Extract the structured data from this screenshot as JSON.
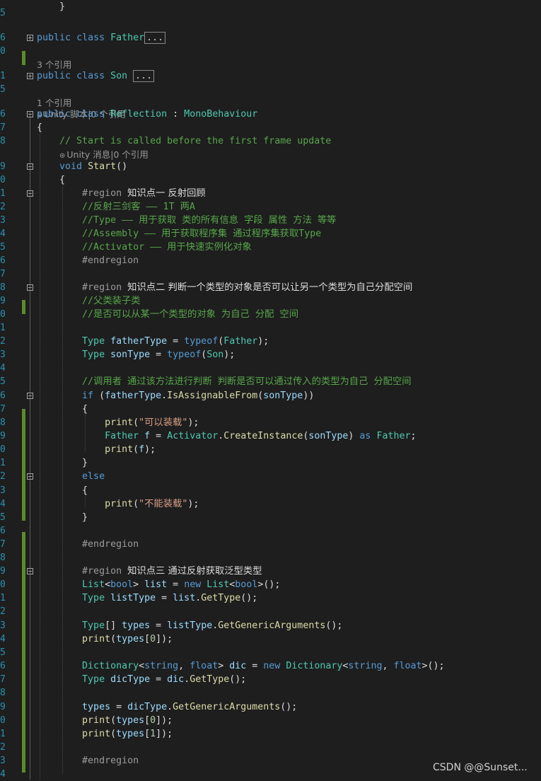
{
  "colors": {
    "background": "#1e1e1e",
    "keyword": "#569cd6",
    "type": "#4ec9b0",
    "comment": "#57a64a",
    "method": "#dcdcaa",
    "string": "#d69d85",
    "number": "#b5cea8",
    "preprocessor": "#9b9b9b",
    "line_number": "#2b91af",
    "change_bar": "#5b8b2b"
  },
  "line_numbers": [
    "5",
    "6",
    "0",
    "",
    "1",
    "5",
    "",
    "6",
    "7",
    "8",
    "",
    "9",
    "0",
    "1",
    "2",
    "3",
    "4",
    "5",
    "6",
    "7",
    "8",
    "9",
    "0",
    "1",
    "2",
    "3",
    "4",
    "5",
    "6",
    "7",
    "8",
    "9",
    "0",
    "1",
    "2",
    "3",
    "4",
    "5",
    "6",
    "7",
    "8",
    "9",
    "0",
    "1",
    "2",
    "3",
    "4",
    "5",
    "6",
    "7",
    "8",
    "9",
    "0",
    "1",
    "2",
    "3",
    "4"
  ],
  "code_lens": {
    "father_refs": "3 个引用",
    "son_refs": "1 个引用",
    "reflection_refs": "Unity 脚本|0 个引用",
    "start_refs": "Unity 消息|0 个引用"
  },
  "collapsed_marker": "...",
  "lines": [
    [],
    [
      {
        "t": "public",
        "c": "kw"
      },
      {
        "t": " "
      },
      {
        "t": "class",
        "c": "kw"
      },
      {
        "t": " "
      },
      {
        "t": "Father",
        "c": "ty"
      }
    ],
    [],
    [],
    [
      {
        "t": "public",
        "c": "kw"
      },
      {
        "t": " "
      },
      {
        "t": "class",
        "c": "kw"
      },
      {
        "t": " "
      },
      {
        "t": "Son",
        "c": "ty"
      },
      {
        "t": " "
      }
    ],
    [],
    [],
    [
      {
        "t": "public",
        "c": "kw"
      },
      {
        "t": " "
      },
      {
        "t": "class",
        "c": "kw"
      },
      {
        "t": " "
      },
      {
        "t": "Reflection",
        "c": "ty"
      },
      {
        "t": " : "
      },
      {
        "t": "MonoBehaviour",
        "c": "ty"
      }
    ],
    [
      {
        "t": "{"
      }
    ],
    [
      {
        "t": "    // Start is called before the first frame update",
        "c": "cm"
      }
    ],
    [],
    [
      {
        "t": "    "
      },
      {
        "t": "void",
        "c": "kw"
      },
      {
        "t": " "
      },
      {
        "t": "Start",
        "c": "fn"
      },
      {
        "t": "()"
      }
    ],
    [
      {
        "t": "    {"
      }
    ],
    [
      {
        "t": "        "
      },
      {
        "t": "#region",
        "c": "pp"
      },
      {
        "t": " "
      },
      {
        "t": "知识点一 反射回顾",
        "c": "cn"
      }
    ],
    [
      {
        "t": "        //反射三剑客 —— 1T 两A",
        "c": "cm"
      }
    ],
    [
      {
        "t": "        //Type —— 用于获取 类的所有信息 字段 属性 方法 等等",
        "c": "cm"
      }
    ],
    [
      {
        "t": "        //Assembly —— 用于获取程序集 通过程序集获取Type",
        "c": "cm"
      }
    ],
    [
      {
        "t": "        //Activator —— 用于快速实例化对象",
        "c": "cm"
      }
    ],
    [
      {
        "t": "        "
      },
      {
        "t": "#endregion",
        "c": "pp"
      }
    ],
    [],
    [
      {
        "t": "        "
      },
      {
        "t": "#region",
        "c": "pp"
      },
      {
        "t": " "
      },
      {
        "t": "知识点二 判断一个类型的对象是否可以让另一个类型为自己分配空间",
        "c": "cn"
      }
    ],
    [
      {
        "t": "        //父类装子类",
        "c": "cm"
      }
    ],
    [
      {
        "t": "        //是否可以从某一个类型的对象 为自己 分配 空间",
        "c": "cm"
      }
    ],
    [],
    [
      {
        "t": "        "
      },
      {
        "t": "Type",
        "c": "ty"
      },
      {
        "t": " "
      },
      {
        "t": "fatherType",
        "c": "id"
      },
      {
        "t": " = "
      },
      {
        "t": "typeof",
        "c": "kw"
      },
      {
        "t": "("
      },
      {
        "t": "Father",
        "c": "ty"
      },
      {
        "t": ");"
      }
    ],
    [
      {
        "t": "        "
      },
      {
        "t": "Type",
        "c": "ty"
      },
      {
        "t": " "
      },
      {
        "t": "sonType",
        "c": "id"
      },
      {
        "t": " = "
      },
      {
        "t": "typeof",
        "c": "kw"
      },
      {
        "t": "("
      },
      {
        "t": "Son",
        "c": "ty"
      },
      {
        "t": ");"
      }
    ],
    [],
    [
      {
        "t": "        //调用者 通过该方法进行判断 判断是否可以通过传入的类型为自己 分配空间",
        "c": "cm"
      }
    ],
    [
      {
        "t": "        "
      },
      {
        "t": "if",
        "c": "kw"
      },
      {
        "t": " ("
      },
      {
        "t": "fatherType",
        "c": "id"
      },
      {
        "t": "."
      },
      {
        "t": "IsAssignableFrom",
        "c": "fn"
      },
      {
        "t": "("
      },
      {
        "t": "sonType",
        "c": "id"
      },
      {
        "t": "))"
      }
    ],
    [
      {
        "t": "        {"
      }
    ],
    [
      {
        "t": "            "
      },
      {
        "t": "print",
        "c": "fn"
      },
      {
        "t": "("
      },
      {
        "t": "\"可以装载\"",
        "c": "st"
      },
      {
        "t": ");"
      }
    ],
    [
      {
        "t": "            "
      },
      {
        "t": "Father",
        "c": "ty"
      },
      {
        "t": " "
      },
      {
        "t": "f",
        "c": "id"
      },
      {
        "t": " = "
      },
      {
        "t": "Activator",
        "c": "ty"
      },
      {
        "t": "."
      },
      {
        "t": "CreateInstance",
        "c": "fn"
      },
      {
        "t": "("
      },
      {
        "t": "sonType",
        "c": "id"
      },
      {
        "t": ") "
      },
      {
        "t": "as",
        "c": "kw"
      },
      {
        "t": " "
      },
      {
        "t": "Father",
        "c": "ty"
      },
      {
        "t": ";"
      }
    ],
    [
      {
        "t": "            "
      },
      {
        "t": "print",
        "c": "fn"
      },
      {
        "t": "("
      },
      {
        "t": "f",
        "c": "id"
      },
      {
        "t": ");"
      }
    ],
    [
      {
        "t": "        }"
      }
    ],
    [
      {
        "t": "        "
      },
      {
        "t": "else",
        "c": "kw"
      }
    ],
    [
      {
        "t": "        {"
      }
    ],
    [
      {
        "t": "            "
      },
      {
        "t": "print",
        "c": "fn"
      },
      {
        "t": "("
      },
      {
        "t": "\"不能装载\"",
        "c": "st"
      },
      {
        "t": ");"
      }
    ],
    [
      {
        "t": "        }"
      }
    ],
    [],
    [
      {
        "t": "        "
      },
      {
        "t": "#endregion",
        "c": "pp"
      }
    ],
    [],
    [
      {
        "t": "        "
      },
      {
        "t": "#region",
        "c": "pp"
      },
      {
        "t": " "
      },
      {
        "t": "知识点三 通过反射获取泛型类型",
        "c": "cn"
      }
    ],
    [
      {
        "t": "        "
      },
      {
        "t": "List",
        "c": "ty"
      },
      {
        "t": "<"
      },
      {
        "t": "bool",
        "c": "kw"
      },
      {
        "t": "> "
      },
      {
        "t": "list",
        "c": "id"
      },
      {
        "t": " = "
      },
      {
        "t": "new",
        "c": "kw"
      },
      {
        "t": " "
      },
      {
        "t": "List",
        "c": "ty"
      },
      {
        "t": "<"
      },
      {
        "t": "bool",
        "c": "kw"
      },
      {
        "t": ">();"
      }
    ],
    [
      {
        "t": "        "
      },
      {
        "t": "Type",
        "c": "ty"
      },
      {
        "t": " "
      },
      {
        "t": "listType",
        "c": "id"
      },
      {
        "t": " = "
      },
      {
        "t": "list",
        "c": "id"
      },
      {
        "t": "."
      },
      {
        "t": "GetType",
        "c": "fn"
      },
      {
        "t": "();"
      }
    ],
    [],
    [
      {
        "t": "        "
      },
      {
        "t": "Type",
        "c": "ty"
      },
      {
        "t": "[] "
      },
      {
        "t": "types",
        "c": "id"
      },
      {
        "t": " = "
      },
      {
        "t": "listType",
        "c": "id"
      },
      {
        "t": "."
      },
      {
        "t": "GetGenericArguments",
        "c": "fn"
      },
      {
        "t": "();"
      }
    ],
    [
      {
        "t": "        "
      },
      {
        "t": "print",
        "c": "fn"
      },
      {
        "t": "("
      },
      {
        "t": "types",
        "c": "id"
      },
      {
        "t": "["
      },
      {
        "t": "0",
        "c": "nm"
      },
      {
        "t": "]);"
      }
    ],
    [],
    [
      {
        "t": "        "
      },
      {
        "t": "Dictionary",
        "c": "ty"
      },
      {
        "t": "<"
      },
      {
        "t": "string",
        "c": "kw"
      },
      {
        "t": ", "
      },
      {
        "t": "float",
        "c": "kw"
      },
      {
        "t": "> "
      },
      {
        "t": "dic",
        "c": "id"
      },
      {
        "t": " = "
      },
      {
        "t": "new",
        "c": "kw"
      },
      {
        "t": " "
      },
      {
        "t": "Dictionary",
        "c": "ty"
      },
      {
        "t": "<"
      },
      {
        "t": "string",
        "c": "kw"
      },
      {
        "t": ", "
      },
      {
        "t": "float",
        "c": "kw"
      },
      {
        "t": ">();"
      }
    ],
    [
      {
        "t": "        "
      },
      {
        "t": "Type",
        "c": "ty"
      },
      {
        "t": " "
      },
      {
        "t": "dicType",
        "c": "id"
      },
      {
        "t": " = "
      },
      {
        "t": "dic",
        "c": "id"
      },
      {
        "t": "."
      },
      {
        "t": "GetType",
        "c": "fn"
      },
      {
        "t": "();"
      }
    ],
    [],
    [
      {
        "t": "        "
      },
      {
        "t": "types",
        "c": "id"
      },
      {
        "t": " = "
      },
      {
        "t": "dicType",
        "c": "id"
      },
      {
        "t": "."
      },
      {
        "t": "GetGenericArguments",
        "c": "fn"
      },
      {
        "t": "();"
      }
    ],
    [
      {
        "t": "        "
      },
      {
        "t": "print",
        "c": "fn"
      },
      {
        "t": "("
      },
      {
        "t": "types",
        "c": "id"
      },
      {
        "t": "["
      },
      {
        "t": "0",
        "c": "nm"
      },
      {
        "t": "]);"
      }
    ],
    [
      {
        "t": "        "
      },
      {
        "t": "print",
        "c": "fn"
      },
      {
        "t": "("
      },
      {
        "t": "types",
        "c": "id"
      },
      {
        "t": "["
      },
      {
        "t": "1",
        "c": "nm"
      },
      {
        "t": "]);"
      }
    ],
    [],
    [
      {
        "t": "        "
      },
      {
        "t": "#endregion",
        "c": "pp"
      }
    ],
    [],
    [
      {
        "t": "    }"
      }
    ]
  ],
  "watermark": "CSDN @@Sunset..."
}
